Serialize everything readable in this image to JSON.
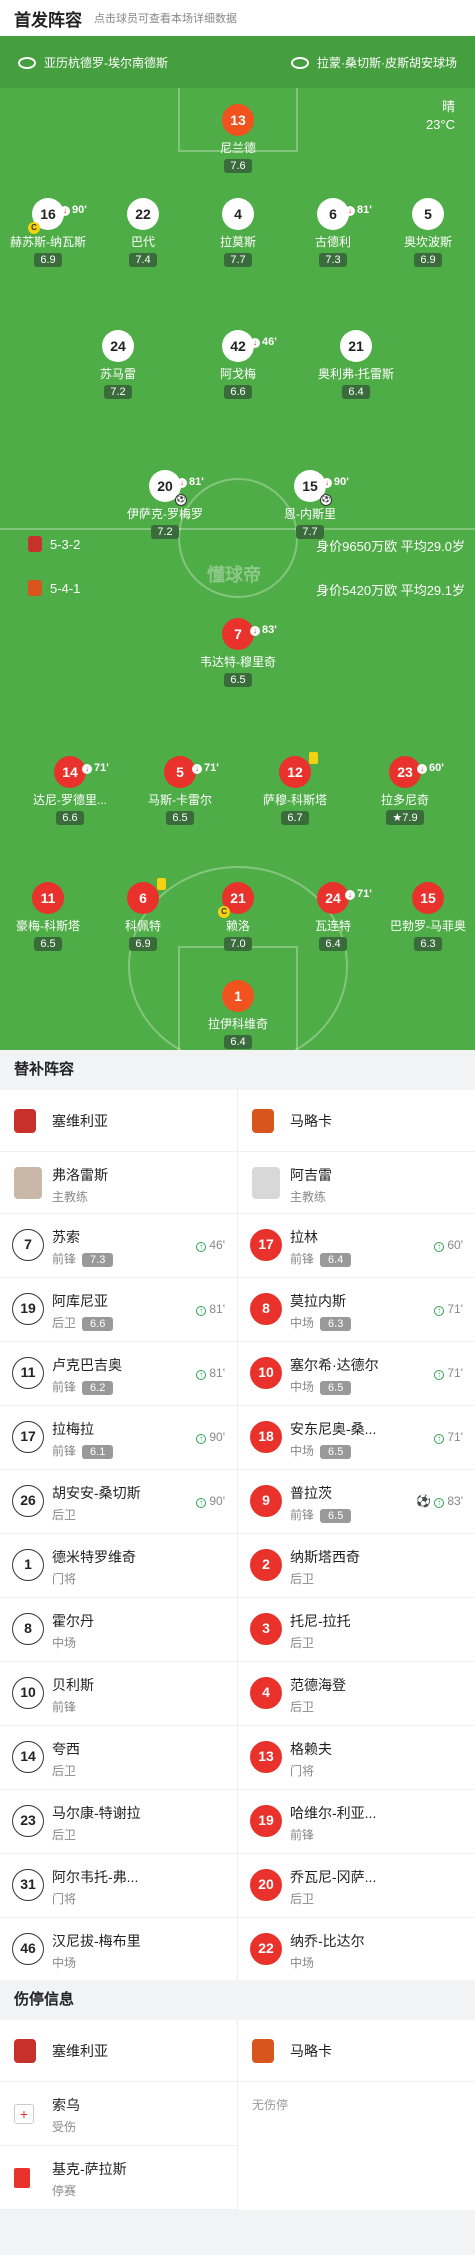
{
  "header": {
    "title": "首发阵容",
    "subtitle": "点击球员可查看本场详细数据"
  },
  "venue": {
    "referee": "亚历杭德罗-埃尔南德斯",
    "stadium": "拉蒙·桑切斯·皮斯胡安球场"
  },
  "weather": {
    "condition": "晴",
    "temp": "23°C"
  },
  "field_info": {
    "home_formation": "5-3-2",
    "home_value": "身价9650万欧 平均29.0岁",
    "away_formation": "5-4-1",
    "away_value": "身价5420万欧 平均29.1岁",
    "watermark": "懂球帝"
  },
  "home_players": [
    {
      "num": "13",
      "name": "尼兰德",
      "rating": "7.6"
    },
    {
      "num": "16",
      "name": "赫苏斯-纳瓦斯",
      "rating": "6.9",
      "sub": "90'"
    },
    {
      "num": "22",
      "name": "巴代",
      "rating": "7.4"
    },
    {
      "num": "4",
      "name": "拉莫斯",
      "rating": "7.7"
    },
    {
      "num": "6",
      "name": "古德利",
      "rating": "7.3",
      "sub": "81'"
    },
    {
      "num": "5",
      "name": "奥坎波斯",
      "rating": "6.9"
    },
    {
      "num": "24",
      "name": "苏马雷",
      "rating": "7.2"
    },
    {
      "num": "42",
      "name": "阿戈梅",
      "rating": "6.6",
      "sub": "46'"
    },
    {
      "num": "21",
      "name": "奥利弗-托雷斯",
      "rating": "6.4"
    },
    {
      "num": "20",
      "name": "伊萨克-罗梅罗",
      "rating": "7.2",
      "sub": "81'"
    },
    {
      "num": "15",
      "name": "恩-内斯里",
      "rating": "7.7",
      "sub": "90'"
    }
  ],
  "away_players": [
    {
      "num": "7",
      "name": "韦达特-穆里奇",
      "rating": "6.5",
      "sub": "83'"
    },
    {
      "num": "14",
      "name": "达尼-罗德里...",
      "rating": "6.6",
      "sub": "71'"
    },
    {
      "num": "5",
      "name": "马斯-卡雷尔",
      "rating": "6.5",
      "sub": "71'"
    },
    {
      "num": "12",
      "name": "萨穆-科斯塔",
      "rating": "6.7"
    },
    {
      "num": "23",
      "name": "拉多尼奇",
      "rating": "7.9",
      "sub": "60'"
    },
    {
      "num": "11",
      "name": "豪梅-科斯塔",
      "rating": "6.5"
    },
    {
      "num": "6",
      "name": "科佩特",
      "rating": "6.9"
    },
    {
      "num": "21",
      "name": "赖洛",
      "rating": "7.0"
    },
    {
      "num": "24",
      "name": "瓦连特",
      "rating": "6.4",
      "sub": "71'"
    },
    {
      "num": "15",
      "name": "巴勃罗-马菲奥",
      "rating": "6.3"
    },
    {
      "num": "1",
      "name": "拉伊科维奇",
      "rating": "6.4"
    }
  ],
  "subs_title": "替补阵容",
  "home_team": "塞维利亚",
  "away_team": "马略卡",
  "home_coach": {
    "name": "弗洛雷斯",
    "role": "主教练"
  },
  "away_coach": {
    "name": "阿吉雷",
    "role": "主教练"
  },
  "home_subs": [
    {
      "num": "7",
      "name": "苏索",
      "pos": "前锋",
      "rating": "7.3",
      "time": "46'"
    },
    {
      "num": "19",
      "name": "阿库尼亚",
      "pos": "后卫",
      "rating": "6.6",
      "time": "81'"
    },
    {
      "num": "11",
      "name": "卢克巴吉奥",
      "pos": "前锋",
      "rating": "6.2",
      "time": "81'"
    },
    {
      "num": "17",
      "name": "拉梅拉",
      "pos": "前锋",
      "rating": "6.1",
      "time": "90'"
    },
    {
      "num": "26",
      "name": "胡安安-桑切斯",
      "pos": "后卫",
      "rating": "",
      "time": "90'"
    },
    {
      "num": "1",
      "name": "德米特罗维奇",
      "pos": "门将",
      "rating": "",
      "time": ""
    },
    {
      "num": "8",
      "name": "霍尔丹",
      "pos": "中场",
      "rating": "",
      "time": ""
    },
    {
      "num": "10",
      "name": "贝利斯",
      "pos": "前锋",
      "rating": "",
      "time": ""
    },
    {
      "num": "14",
      "name": "夸西",
      "pos": "后卫",
      "rating": "",
      "time": ""
    },
    {
      "num": "23",
      "name": "马尔康-特谢拉",
      "pos": "后卫",
      "rating": "",
      "time": ""
    },
    {
      "num": "31",
      "name": "阿尔韦托-弗...",
      "pos": "门将",
      "rating": "",
      "time": ""
    },
    {
      "num": "46",
      "name": "汉尼拔-梅布里",
      "pos": "中场",
      "rating": "",
      "time": ""
    }
  ],
  "away_subs": [
    {
      "num": "17",
      "name": "拉林",
      "pos": "前锋",
      "rating": "6.4",
      "time": "60'"
    },
    {
      "num": "8",
      "name": "莫拉内斯",
      "pos": "中场",
      "rating": "6.3",
      "time": "71'"
    },
    {
      "num": "10",
      "name": "塞尔希·达德尔",
      "pos": "中场",
      "rating": "6.5",
      "time": "71'"
    },
    {
      "num": "18",
      "name": "安东尼奥-桑...",
      "pos": "中场",
      "rating": "6.5",
      "time": "71'"
    },
    {
      "num": "9",
      "name": "普拉茨",
      "pos": "前锋",
      "rating": "6.5",
      "time": "83'"
    },
    {
      "num": "2",
      "name": "纳斯塔西奇",
      "pos": "后卫",
      "rating": "",
      "time": ""
    },
    {
      "num": "3",
      "name": "托尼-拉托",
      "pos": "后卫",
      "rating": "",
      "time": ""
    },
    {
      "num": "4",
      "name": "范德海登",
      "pos": "后卫",
      "rating": "",
      "time": ""
    },
    {
      "num": "13",
      "name": "格赖夫",
      "pos": "门将",
      "rating": "",
      "time": ""
    },
    {
      "num": "19",
      "name": "哈维尔-利亚...",
      "pos": "前锋",
      "rating": "",
      "time": ""
    },
    {
      "num": "20",
      "name": "乔瓦尼-冈萨...",
      "pos": "后卫",
      "rating": "",
      "time": ""
    },
    {
      "num": "22",
      "name": "纳乔-比达尔",
      "pos": "中场",
      "rating": "",
      "time": ""
    }
  ],
  "injury_title": "伤停信息",
  "home_injuries": [
    {
      "name": "索乌",
      "status": "受伤"
    },
    {
      "name": "基克-萨拉斯",
      "status": "停赛"
    }
  ],
  "away_injuries_text": "无伤停",
  "colors": {
    "pitch": "#4fad47",
    "away_circle": "#e8322b",
    "gk": "#f0531d",
    "sub_green": "#27a84b"
  }
}
